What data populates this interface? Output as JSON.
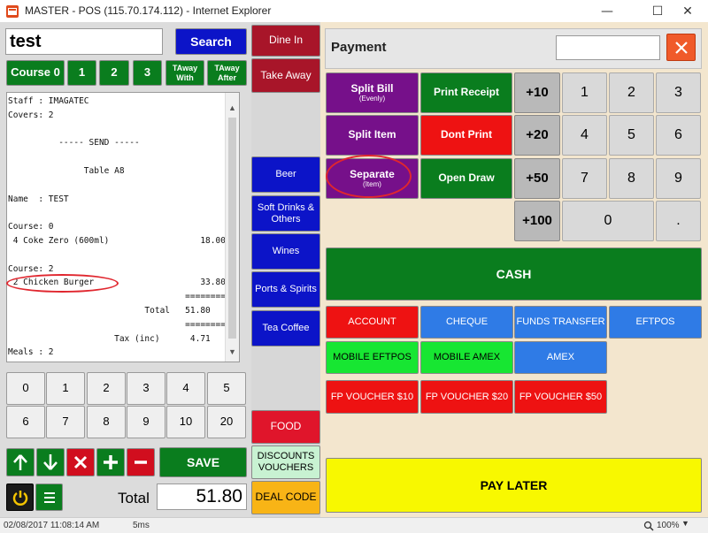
{
  "window": {
    "title": "MASTER - POS (115.70.174.112) - Internet Explorer"
  },
  "search": {
    "value": "test",
    "button": "Search"
  },
  "course_row": {
    "course": "Course 0",
    "one": "1",
    "two": "2",
    "three": "3",
    "taway_with_1": "TAway",
    "taway_with_2": "With",
    "taway_after_1": "TAway",
    "taway_after_2": "After"
  },
  "receipt": {
    "text": "Staff : IMAGATEC\nCovers: 2\n\n          ----- SEND -----\n\n               Table A8\n\nName  : TEST\n\nCourse: 0\n 4 Coke Zero (600ml)                  18.00\n\nCourse: 2\n 2 Chicken Burger                     33.80\n                                   ========\n                           Total   51.80\n                                   ========\n                     Tax (inc)      4.71\nMeals : 2"
  },
  "keypad": [
    "0",
    "1",
    "2",
    "3",
    "4",
    "5",
    "6",
    "7",
    "8",
    "9",
    "10",
    "20"
  ],
  "action_row": {
    "save": "SAVE"
  },
  "total": {
    "label": "Total",
    "value": "51.80"
  },
  "middle_column": {
    "dine_in": "Dine In",
    "take_away": "Take Away",
    "categories": [
      {
        "label": "Beer"
      },
      {
        "label": "Soft Drinks & Others"
      },
      {
        "label": "Wines"
      },
      {
        "label": "Ports & Spirits"
      },
      {
        "label": "Tea Coffee"
      }
    ],
    "food": "FOOD",
    "discounts": "DISCOUNTS VOUCHERS",
    "deal_code": "DEAL CODE"
  },
  "payment": {
    "title": "Payment",
    "input_value": "",
    "split_bill": "Split Bill",
    "split_bill_sub": "(Evenly)",
    "split_item": "Split Item",
    "separate": "Separate",
    "separate_sub": "(Item)",
    "print_receipt": "Print Receipt",
    "dont_print": "Dont Print",
    "open_draw": "Open Draw",
    "plus10": "+10",
    "plus20": "+20",
    "plus50": "+50",
    "plus100": "+100",
    "num": [
      "1",
      "2",
      "3",
      "4",
      "5",
      "6",
      "7",
      "8",
      "9",
      "0",
      "."
    ],
    "cash": "CASH",
    "methods_row1": [
      "ACCOUNT",
      "CHEQUE",
      "FUNDS TRANSFER",
      "EFTPOS"
    ],
    "methods_row2": [
      "MOBILE EFTPOS",
      "MOBILE AMEX",
      "AMEX"
    ],
    "vouchers": [
      "FP VOUCHER $10",
      "FP VOUCHER $20",
      "FP VOUCHER $50"
    ],
    "pay_later": "PAY LATER"
  },
  "statusbar": {
    "datetime": "02/08/2017 11:08:14 AM",
    "latency": "5ms",
    "zoom": "100%"
  },
  "icons": [
    "close-icon",
    "minimize-icon",
    "maximize-icon",
    "arrow-up-icon",
    "arrow-down-icon",
    "delete-icon",
    "plus-icon",
    "minus-icon",
    "power-icon",
    "menu-icon",
    "zoom-icon"
  ],
  "colors": {
    "green": "#0a7d1e",
    "purple": "#76108a",
    "red": "#ee1212",
    "blue": "#2f7be6",
    "dark_blue": "#0c14c8",
    "yellow": "#f8f800",
    "annotation": "#e0262e"
  }
}
